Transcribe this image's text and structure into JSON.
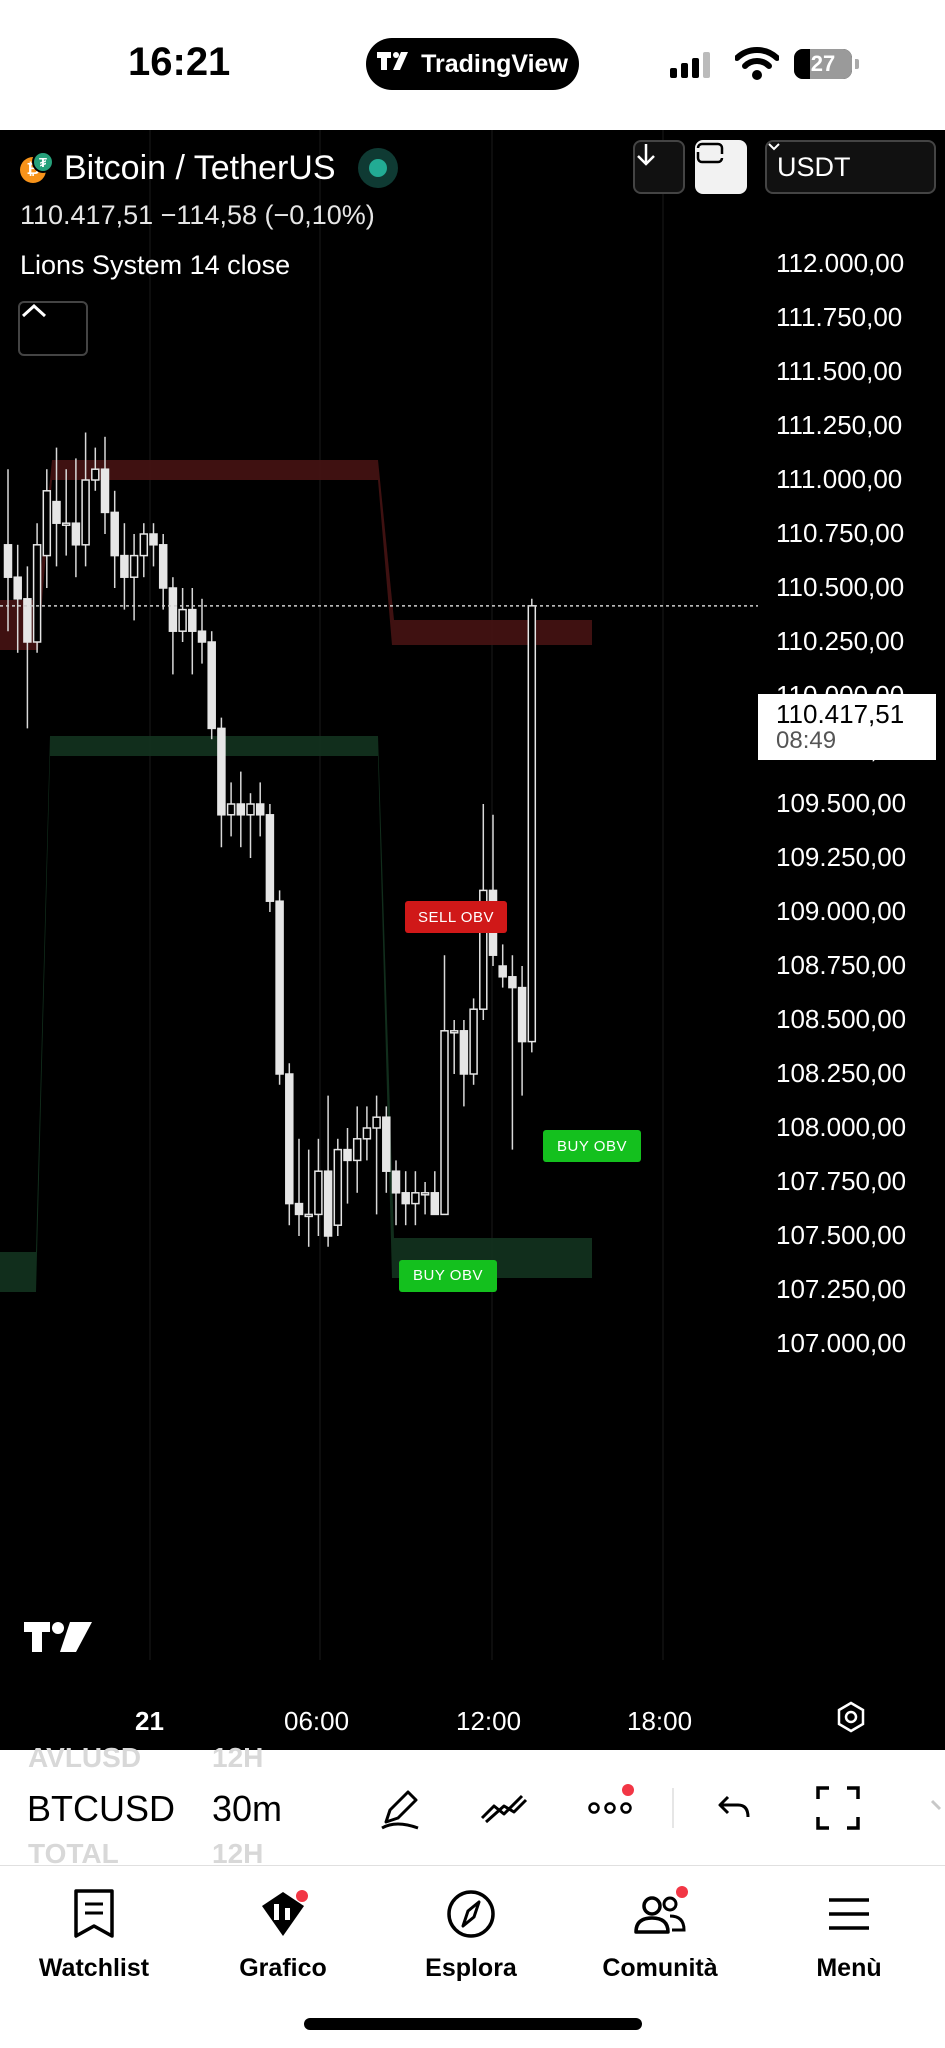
{
  "status_bar": {
    "time": "16:21",
    "app_pill": "TradingView",
    "battery": "27"
  },
  "header": {
    "symbol_name": "Bitcoin / TetherUS",
    "price_line": "110.417,51  −114,58 (−0,10%)",
    "indicator": "Lions System 14 close",
    "currency": "USDT"
  },
  "chart_data": {
    "type": "candlestick",
    "y_axis_labels": [
      "112.000,00",
      "111.750,00",
      "111.500,00",
      "111.250,00",
      "111.000,00",
      "110.750,00",
      "110.500,00",
      "110.250,00",
      "110.000,00",
      "109.750,00",
      "109.500,00",
      "109.250,00",
      "109.000,00",
      "108.750,00",
      "108.500,00",
      "108.250,00",
      "108.000,00",
      "107.750,00",
      "107.500,00",
      "107.250,00",
      "107.000,00"
    ],
    "x_axis_labels": [
      "21",
      "06:00",
      "12:00",
      "18:00"
    ],
    "ylim": [
      107000,
      112000
    ],
    "last_price": {
      "value": "110.417,51",
      "countdown": "08:49"
    },
    "signals": [
      {
        "label": "SELL OBV",
        "type": "sell",
        "price": 108800
      },
      {
        "label": "BUY OBV",
        "type": "buy",
        "price": 107520
      },
      {
        "label": "BUY OBV",
        "type": "buy",
        "price": 108120
      }
    ],
    "candles": [
      {
        "o": 110700,
        "c": 110550,
        "h": 111050,
        "l": 110300
      },
      {
        "o": 110550,
        "c": 110450,
        "h": 110700,
        "l": 110200
      },
      {
        "o": 110450,
        "c": 110250,
        "h": 110600,
        "l": 109850
      },
      {
        "o": 110250,
        "c": 110700,
        "h": 110800,
        "l": 110200
      },
      {
        "o": 110650,
        "c": 110950,
        "h": 111050,
        "l": 110500
      },
      {
        "o": 110900,
        "c": 110800,
        "h": 111150,
        "l": 110600
      },
      {
        "o": 110800,
        "c": 110800,
        "h": 111050,
        "l": 110650
      },
      {
        "o": 110800,
        "c": 110700,
        "h": 111100,
        "l": 110550
      },
      {
        "o": 110700,
        "c": 111000,
        "h": 111220,
        "l": 110600
      },
      {
        "o": 111000,
        "c": 111050,
        "h": 111150,
        "l": 110950
      },
      {
        "o": 111050,
        "c": 110850,
        "h": 111200,
        "l": 110750
      },
      {
        "o": 110850,
        "c": 110650,
        "h": 110950,
        "l": 110500
      },
      {
        "o": 110650,
        "c": 110550,
        "h": 110800,
        "l": 110400
      },
      {
        "o": 110550,
        "c": 110650,
        "h": 110750,
        "l": 110350
      },
      {
        "o": 110650,
        "c": 110750,
        "h": 110800,
        "l": 110550
      },
      {
        "o": 110750,
        "c": 110700,
        "h": 110800,
        "l": 110600
      },
      {
        "o": 110700,
        "c": 110500,
        "h": 110750,
        "l": 110400
      },
      {
        "o": 110500,
        "c": 110300,
        "h": 110550,
        "l": 110100
      },
      {
        "o": 110300,
        "c": 110400,
        "h": 110500,
        "l": 110250
      },
      {
        "o": 110400,
        "c": 110300,
        "h": 110500,
        "l": 110100
      },
      {
        "o": 110300,
        "c": 110250,
        "h": 110450,
        "l": 110150
      },
      {
        "o": 110250,
        "c": 109850,
        "h": 110300,
        "l": 109800
      },
      {
        "o": 109850,
        "c": 109450,
        "h": 109900,
        "l": 109300
      },
      {
        "o": 109450,
        "c": 109500,
        "h": 109600,
        "l": 109350
      },
      {
        "o": 109500,
        "c": 109450,
        "h": 109650,
        "l": 109300
      },
      {
        "o": 109450,
        "c": 109500,
        "h": 109550,
        "l": 109250
      },
      {
        "o": 109500,
        "c": 109450,
        "h": 109600,
        "l": 109350
      },
      {
        "o": 109450,
        "c": 109050,
        "h": 109500,
        "l": 109000
      },
      {
        "o": 109050,
        "c": 108250,
        "h": 109100,
        "l": 108200
      },
      {
        "o": 108250,
        "c": 107650,
        "h": 108300,
        "l": 107550
      },
      {
        "o": 107650,
        "c": 107600,
        "h": 107950,
        "l": 107500
      },
      {
        "o": 107600,
        "c": 107600,
        "h": 107900,
        "l": 107450
      },
      {
        "o": 107600,
        "c": 107800,
        "h": 107950,
        "l": 107500
      },
      {
        "o": 107800,
        "c": 107500,
        "h": 108150,
        "l": 107450
      },
      {
        "o": 107550,
        "c": 107900,
        "h": 107950,
        "l": 107500
      },
      {
        "o": 107900,
        "c": 107850,
        "h": 108000,
        "l": 107650
      },
      {
        "o": 107850,
        "c": 107950,
        "h": 108100,
        "l": 107700
      },
      {
        "o": 107950,
        "c": 108000,
        "h": 108100,
        "l": 107850
      },
      {
        "o": 108000,
        "c": 108050,
        "h": 108150,
        "l": 107600
      },
      {
        "o": 108050,
        "c": 107800,
        "h": 108100,
        "l": 107700
      },
      {
        "o": 107800,
        "c": 107700,
        "h": 107850,
        "l": 107550
      },
      {
        "o": 107700,
        "c": 107650,
        "h": 107800,
        "l": 107550
      },
      {
        "o": 107650,
        "c": 107700,
        "h": 107800,
        "l": 107550
      },
      {
        "o": 107700,
        "c": 107700,
        "h": 107750,
        "l": 107600
      },
      {
        "o": 107700,
        "c": 107600,
        "h": 107800,
        "l": 107600
      },
      {
        "o": 107600,
        "c": 108450,
        "h": 108800,
        "l": 107600
      },
      {
        "o": 108450,
        "c": 108450,
        "h": 108500,
        "l": 108250
      },
      {
        "o": 108450,
        "c": 108250,
        "h": 108500,
        "l": 108100
      },
      {
        "o": 108250,
        "c": 108550,
        "h": 108600,
        "l": 108200
      },
      {
        "o": 108550,
        "c": 109100,
        "h": 109500,
        "l": 108500
      },
      {
        "o": 109100,
        "c": 108800,
        "h": 109450,
        "l": 108750
      },
      {
        "o": 108750,
        "c": 108700,
        "h": 108850,
        "l": 108650
      },
      {
        "o": 108700,
        "c": 108650,
        "h": 108800,
        "l": 107900
      },
      {
        "o": 108650,
        "c": 108400,
        "h": 108750,
        "l": 108150
      },
      {
        "o": 108400,
        "c": 110417.51,
        "h": 110450,
        "l": 108350
      }
    ]
  },
  "toolbar": {
    "ghost_top_symbol": "AVLUSD",
    "ghost_top_interval": "12H",
    "symbol": "BTCUSD",
    "interval": "30m",
    "ghost_bottom_symbol": "TOTAL",
    "ghost_bottom_interval": "12H"
  },
  "bottom_nav": [
    {
      "label": "Watchlist",
      "icon": "watchlist-icon"
    },
    {
      "label": "Grafico",
      "icon": "chart-icon"
    },
    {
      "label": "Esplora",
      "icon": "compass-icon"
    },
    {
      "label": "Comunità",
      "icon": "community-icon"
    },
    {
      "label": "Menù",
      "icon": "hamburger-icon"
    }
  ],
  "colors": {
    "up_candle": "#e6e6e6",
    "down_candle": "#e6e6e6",
    "resistance_zone": "#4a1414",
    "support_zone": "#13331f",
    "sell_signal": "#d01818",
    "buy_signal": "#14c01e",
    "accent_red_dot": "#f23645"
  }
}
